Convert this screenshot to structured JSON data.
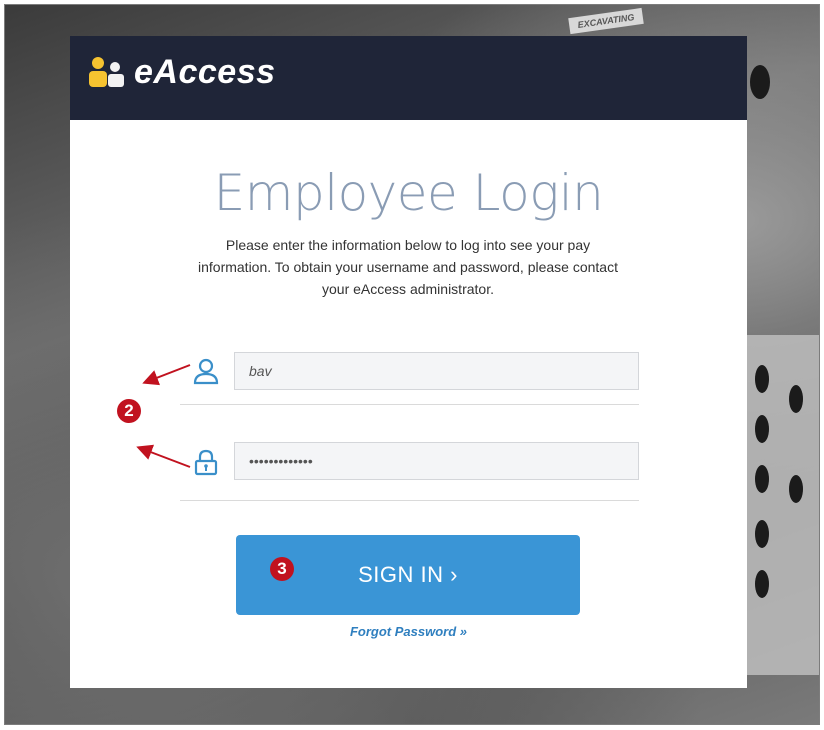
{
  "brand": {
    "name": "eAccess",
    "accent": "#3a95d6",
    "header_bg": "#1f2538",
    "logo_color": "#f6c330"
  },
  "background": {
    "sign_text": "EXCAVATING"
  },
  "page": {
    "title": "Employee Login",
    "description": "Please enter the information below to log into see your pay information. To obtain your username and password, please contact your eAccess administrator."
  },
  "form": {
    "username": {
      "value": "bav",
      "icon": "user-icon"
    },
    "password": {
      "value": "•••••••••••••",
      "icon": "lock-icon"
    },
    "sign_in_label": "SIGN IN ›",
    "forgot_label": "Forgot Password  »"
  },
  "annotations": {
    "step_2": "2",
    "step_3": "3",
    "color": "#c1121f"
  }
}
